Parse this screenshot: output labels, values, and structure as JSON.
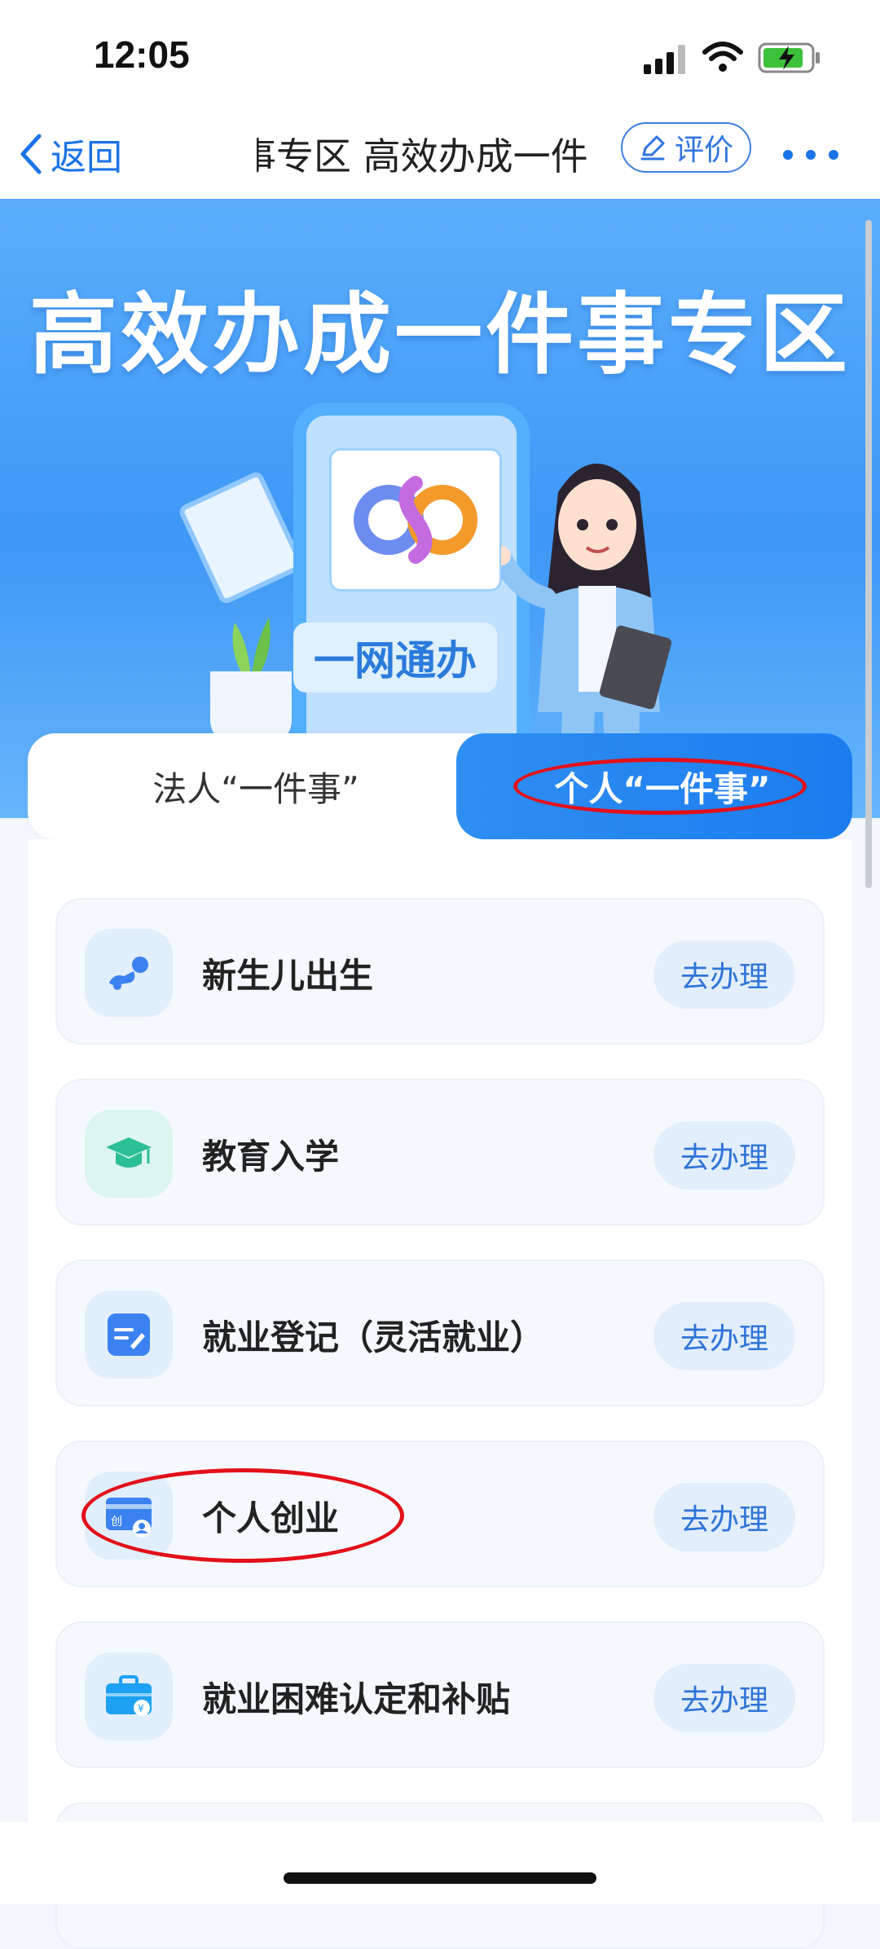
{
  "status_bar": {
    "time": "12:05"
  },
  "nav": {
    "back_label": "返回",
    "title": "事专区  高效办成一件",
    "rate_label": "评价"
  },
  "banner": {
    "title": "高效办成一件事专区",
    "phone_badge": "一网通办"
  },
  "tabs": {
    "legal": "法人“一件事”",
    "personal": "个人“一件事”",
    "selected": "personal"
  },
  "items": [
    {
      "label": "新生儿出生",
      "action": "去办理",
      "icon": "baby-icon"
    },
    {
      "label": "教育入学",
      "action": "去办理",
      "icon": "graduation-cap-icon"
    },
    {
      "label": "就业登记（灵活就业）",
      "action": "去办理",
      "icon": "form-edit-icon"
    },
    {
      "label": "个人创业",
      "action": "去办理",
      "icon": "business-card-icon"
    },
    {
      "label": "就业困难认定和补贴",
      "action": "去办理",
      "icon": "briefcase-money-icon"
    }
  ],
  "colors": {
    "accent": "#1a73e8",
    "banner": "#4a9ff7",
    "highlight": "#e3101a"
  }
}
